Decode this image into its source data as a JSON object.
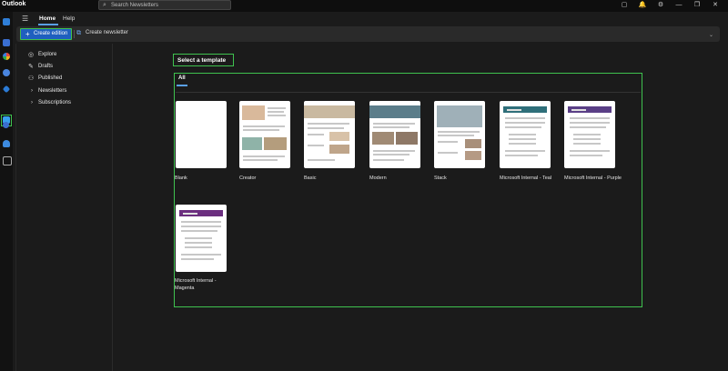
{
  "app": {
    "title": "Outlook"
  },
  "search": {
    "placeholder": "Search Newsletters"
  },
  "titlebar_icons": [
    "notes-icon",
    "bell-icon",
    "settings-icon",
    "minimize-icon",
    "restore-icon",
    "close-icon"
  ],
  "titlebar_glyphs": [
    "▢",
    "🔔",
    "⚙",
    "—",
    "❐",
    "✕"
  ],
  "nav": {
    "tabs": [
      {
        "label": "Home",
        "active": true
      },
      {
        "label": "Help",
        "active": false
      }
    ]
  },
  "ribbon": {
    "create_edition": "Create edition",
    "create_newsletter": "Create newsletter"
  },
  "sidebar": {
    "items": [
      {
        "label": "Explore",
        "icon": "compass-icon"
      },
      {
        "label": "Drafts",
        "icon": "pencil-icon"
      },
      {
        "label": "Published",
        "icon": "person-icon"
      },
      {
        "label": "Newsletters",
        "icon": "chevron-right-icon"
      },
      {
        "label": "Subscriptions",
        "icon": "chevron-right-icon"
      }
    ]
  },
  "main": {
    "section_title": "Select a template",
    "filter_tab": "All",
    "templates": [
      {
        "label": "Blank",
        "style": "blank"
      },
      {
        "label": "Creator",
        "style": "creator"
      },
      {
        "label": "Basic",
        "style": "basic"
      },
      {
        "label": "Modern",
        "style": "modern"
      },
      {
        "label": "Stack",
        "style": "stack"
      },
      {
        "label": "Microsoft Internal - Teal",
        "style": "banner",
        "accent": "#2f6f7a"
      },
      {
        "label": "Microsoft Internal - Purple",
        "style": "banner",
        "accent": "#5a3f86"
      },
      {
        "label": "Microsoft Internal - Magenta",
        "style": "banner",
        "accent": "#6b2e7f"
      }
    ]
  },
  "colors": {
    "accent": "#1f5fbf",
    "highlight": "#3fc24f"
  }
}
